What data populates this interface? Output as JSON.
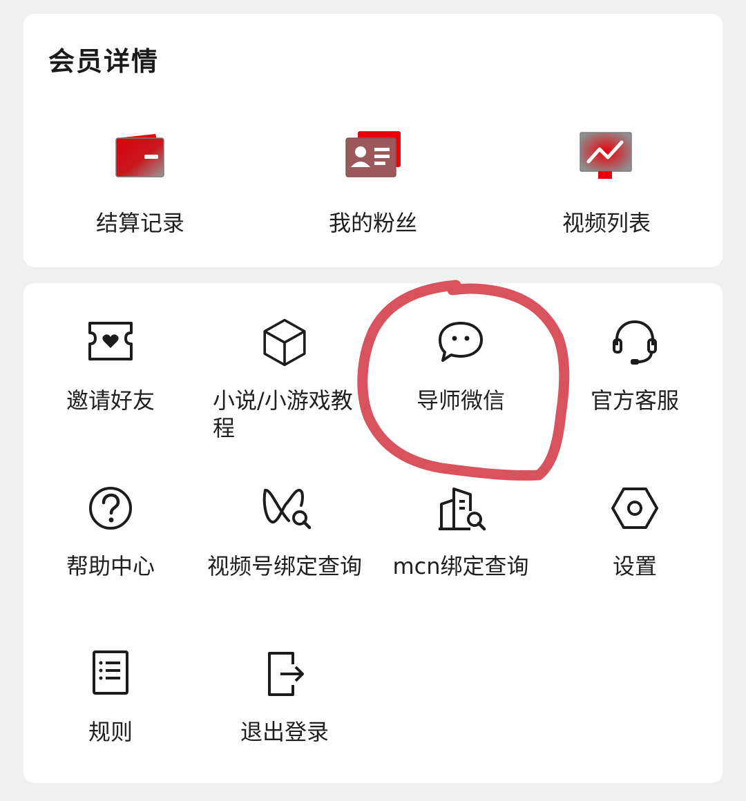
{
  "member_card": {
    "title": "会员详情",
    "items": [
      {
        "label": "结算记录",
        "icon": "wallet-icon"
      },
      {
        "label": "我的粉丝",
        "icon": "id-card-icon"
      },
      {
        "label": "视频列表",
        "icon": "chart-board-icon"
      }
    ]
  },
  "tools_card": {
    "items": [
      {
        "label": "邀请好友",
        "icon": "ticket-heart-icon"
      },
      {
        "label": "小说/小游戏教程",
        "icon": "cube-icon"
      },
      {
        "label": "导师微信",
        "icon": "chat-bubble-icon"
      },
      {
        "label": "官方客服",
        "icon": "headset-icon"
      },
      {
        "label": "帮助中心",
        "icon": "help-circle-icon"
      },
      {
        "label": "视频号绑定查询",
        "icon": "channel-search-icon"
      },
      {
        "label": "mcn绑定查询",
        "icon": "building-search-icon"
      },
      {
        "label": "设置",
        "icon": "settings-hex-icon"
      },
      {
        "label": "规则",
        "icon": "rules-list-icon"
      },
      {
        "label": "退出登录",
        "icon": "logout-icon"
      }
    ]
  },
  "colors": {
    "accent_red": "#e8000b",
    "annotation_circle": "#d9535f"
  }
}
